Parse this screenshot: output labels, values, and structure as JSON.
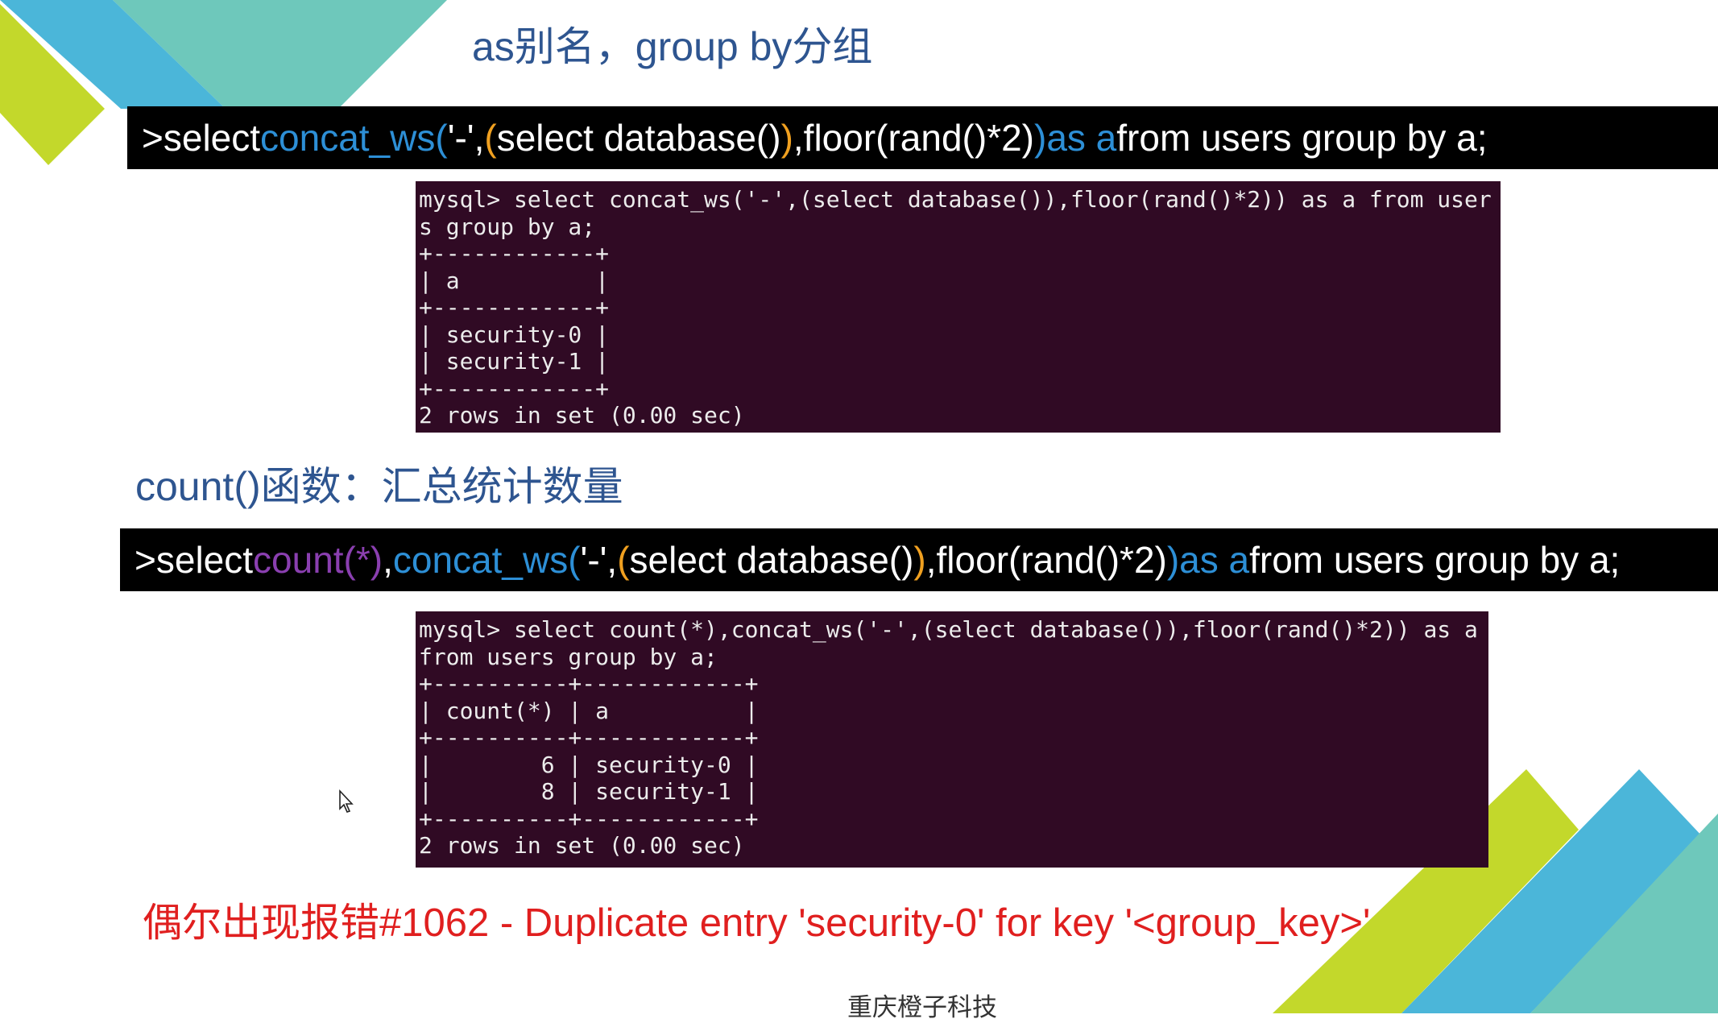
{
  "colors": {
    "title_blue": "#2e5590",
    "keyword_blue": "#2d8fd6",
    "paren_orange": "#f0a020",
    "func_purple": "#8a3fb0",
    "terminal_bg": "#300a24",
    "error_red": "#e01f1f",
    "deco_green": "#c3d82b",
    "deco_blue": "#4bb6d9",
    "deco_teal": "#6ec8bb"
  },
  "slide": {
    "title": "as别名，group by分组",
    "section_heading": "count()函数：汇总统计数量",
    "error_note": "偶尔出现报错#1062 - Duplicate entry 'security-0' for key '<group_key>'",
    "footer": "重庆橙子科技"
  },
  "command1": {
    "p1": ">select ",
    "p2": "concat_ws(",
    "p3": "'-',",
    "p4": "(",
    "p5": "select database()",
    "p6": ")",
    "p7": ",floor(rand()*2)",
    "p8": ")",
    "p9": " as a",
    "p10": " from users group by a;"
  },
  "command2": {
    "p1": ">select ",
    "p2": "count(*)",
    "p3": ",",
    "p4": "concat_ws(",
    "p5": "'-',",
    "p6": "(",
    "p7": "select database()",
    "p8": ")",
    "p9": ",floor(rand()*2)",
    "p10": ")",
    "p11": " as a",
    "p12": " from users group by a;"
  },
  "terminal1": {
    "lines": [
      "mysql> select concat_ws('-',(select database()),floor(rand()*2)) as a from user",
      "s group by a;",
      "+------------+",
      "| a          |",
      "+------------+",
      "| security-0 |",
      "| security-1 |",
      "+------------+",
      "2 rows in set (0.00 sec)"
    ]
  },
  "terminal2": {
    "lines": [
      "mysql> select count(*),concat_ws('-',(select database()),floor(rand()*2)) as a",
      "from users group by a;",
      "+----------+------------+",
      "| count(*) | a          |",
      "+----------+------------+",
      "|        6 | security-0 |",
      "|        8 | security-1 |",
      "+----------+------------+",
      "2 rows in set (0.00 sec)"
    ]
  },
  "icons": {
    "cursor": "mouse-pointer-icon"
  }
}
